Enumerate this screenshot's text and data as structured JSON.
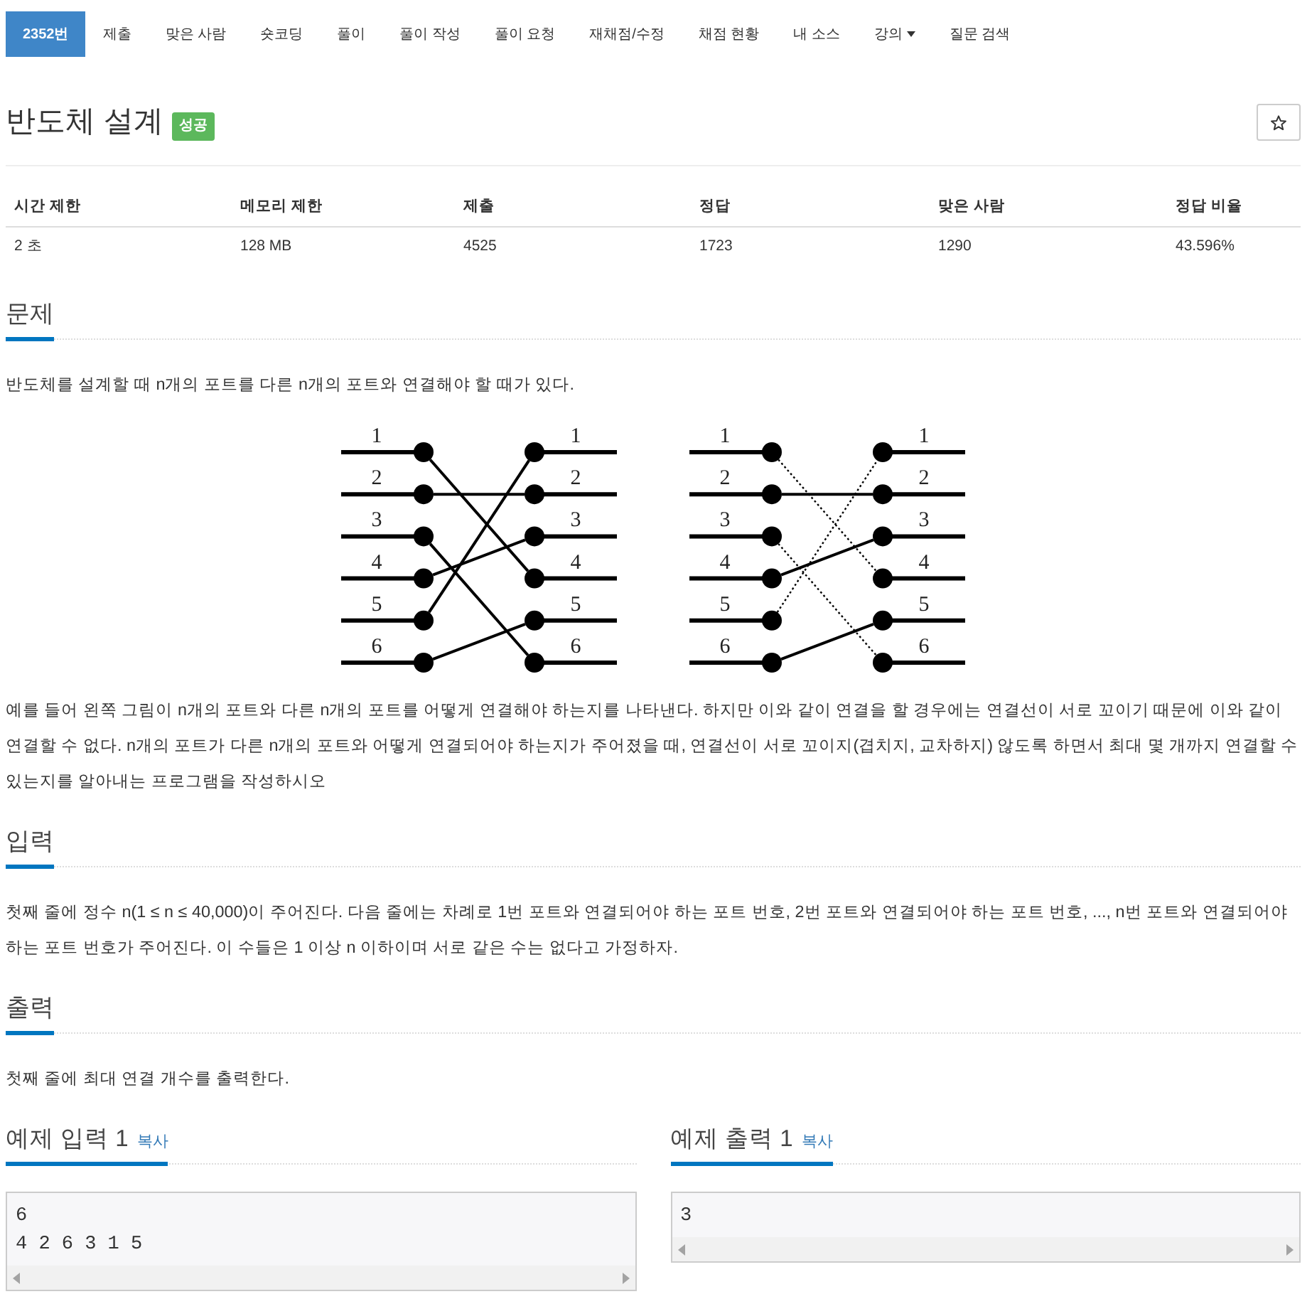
{
  "nav": {
    "tabs": [
      {
        "label": "2352번",
        "selected": true,
        "dropdown": false
      },
      {
        "label": "제출",
        "selected": false,
        "dropdown": false
      },
      {
        "label": "맞은 사람",
        "selected": false,
        "dropdown": false
      },
      {
        "label": "숏코딩",
        "selected": false,
        "dropdown": false
      },
      {
        "label": "풀이",
        "selected": false,
        "dropdown": false
      },
      {
        "label": "풀이 작성",
        "selected": false,
        "dropdown": false
      },
      {
        "label": "풀이 요청",
        "selected": false,
        "dropdown": false
      },
      {
        "label": "재채점/수정",
        "selected": false,
        "dropdown": false
      },
      {
        "label": "채점 현황",
        "selected": false,
        "dropdown": false
      },
      {
        "label": "내 소스",
        "selected": false,
        "dropdown": false
      },
      {
        "label": "강의",
        "selected": false,
        "dropdown": true
      },
      {
        "label": "질문 검색",
        "selected": false,
        "dropdown": false
      }
    ]
  },
  "problem": {
    "title": "반도체 설계",
    "status_badge": "성공"
  },
  "info_table": {
    "columns": [
      "시간 제한",
      "메모리 제한",
      "제출",
      "정답",
      "맞은 사람",
      "정답 비율"
    ],
    "rows": [
      [
        "2 초",
        "128 MB",
        "4525",
        "1723",
        "1290",
        "43.596%"
      ]
    ]
  },
  "sections": [
    {
      "heading": "문제",
      "blocks": [
        {
          "kind": "paragraph",
          "text": "반도체를 설계할 때 n개의 포트를 다른 n개의 포트와 연결해야 할 때가 있다."
        },
        {
          "kind": "figure",
          "panels": [
            {
              "left_ports": [
                "1",
                "2",
                "3",
                "4",
                "5",
                "6"
              ],
              "right_ports": [
                "1",
                "2",
                "3",
                "4",
                "5",
                "6"
              ],
              "wires": [
                {
                  "kind": "solid"
                },
                {
                  "kind": "solid"
                },
                {
                  "kind": "solid"
                },
                {
                  "kind": "solid"
                },
                {
                  "kind": "solid"
                },
                {
                  "kind": "solid"
                }
              ]
            },
            {
              "left_ports": [
                "1",
                "2",
                "3",
                "4",
                "5",
                "6"
              ],
              "right_ports": [
                "1",
                "2",
                "3",
                "4",
                "5",
                "6"
              ],
              "wires": [
                {
                  "kind": "dotted"
                },
                {
                  "kind": "solid"
                },
                {
                  "kind": "dotted"
                },
                {
                  "kind": "solid"
                },
                {
                  "kind": "dotted"
                },
                {
                  "kind": "solid"
                }
              ]
            }
          ]
        },
        {
          "kind": "paragraph",
          "text": "예를 들어 왼쪽 그림이 n개의 포트와 다른 n개의 포트를 어떻게 연결해야 하는지를 나타낸다. 하지만 이와 같이 연결을 할 경우에는 연결선이 서로 꼬이기 때문에 이와 같이 연결할 수 없다. n개의 포트가 다른 n개의 포트와 어떻게 연결되어야 하는지가 주어졌을 때, 연결선이 서로 꼬이지(겹치지, 교차하지) 않도록 하면서 최대 몇 개까지 연결할 수 있는지를 알아내는 프로그램을 작성하시오"
        }
      ]
    },
    {
      "heading": "입력",
      "blocks": [
        {
          "kind": "paragraph",
          "text": "첫째 줄에 정수 n(1 ≤ n ≤ 40,000)이 주어진다. 다음 줄에는 차례로 1번 포트와 연결되어야 하는 포트 번호, 2번 포트와 연결되어야 하는 포트 번호, ..., n번 포트와 연결되어야 하는 포트 번호가 주어진다. 이 수들은 1 이상 n 이하이며 서로 같은 수는 없다고 가정하자."
        }
      ]
    },
    {
      "heading": "출력",
      "blocks": [
        {
          "kind": "paragraph",
          "text": "첫째 줄에 최대 연결 개수를 출력한다."
        }
      ]
    }
  ],
  "samples": [
    {
      "heading": "예제 입력 1",
      "copy_label": "복사",
      "lines": [
        "6",
        "4 2 6 3 1 5"
      ]
    },
    {
      "heading": "예제 출력 1",
      "copy_label": "복사",
      "lines": [
        "3"
      ]
    }
  ]
}
